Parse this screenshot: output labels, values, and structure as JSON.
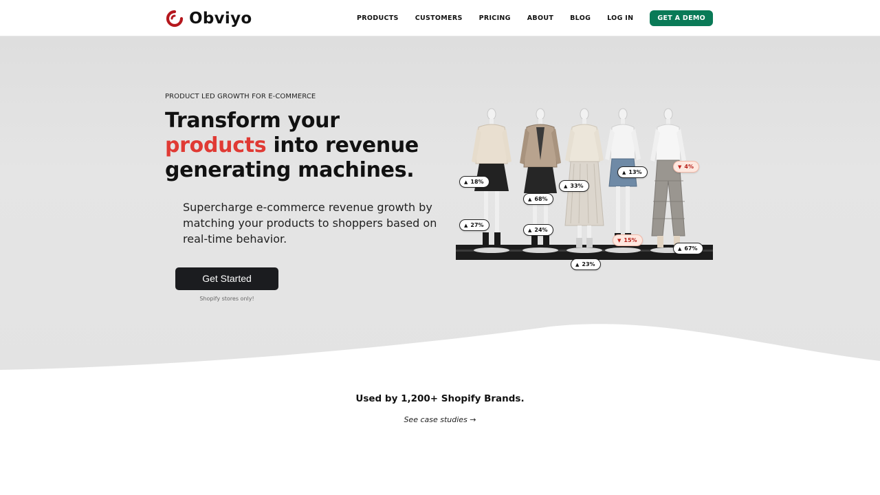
{
  "brand": {
    "name": "Obviyo",
    "accent_color": "#e03a34",
    "logo_icon": "obviyo-logo-icon"
  },
  "nav": {
    "items": [
      {
        "label": "PRODUCTS"
      },
      {
        "label": "CUSTOMERS"
      },
      {
        "label": "PRICING"
      },
      {
        "label": "ABOUT"
      },
      {
        "label": "BLOG"
      },
      {
        "label": "LOG IN"
      }
    ],
    "demo_label": "GET A DEMO",
    "demo_color": "#0a7a57"
  },
  "hero": {
    "eyebrow": "PRODUCT LED GROWTH FOR E-COMMERCE",
    "headline_line1": "Transform your",
    "headline_accent": "products",
    "headline_rest": " into revenue generating machines.",
    "subtext": "Supercharge e-commerce revenue growth by matching your products to shoppers based on real-time behavior.",
    "cta_label": "Get Started",
    "cta_note": "Shopify stores only!",
    "badges": [
      {
        "value": "18%",
        "direction": "up"
      },
      {
        "value": "27%",
        "direction": "up"
      },
      {
        "value": "68%",
        "direction": "up"
      },
      {
        "value": "24%",
        "direction": "up"
      },
      {
        "value": "33%",
        "direction": "up"
      },
      {
        "value": "23%",
        "direction": "up"
      },
      {
        "value": "13%",
        "direction": "up"
      },
      {
        "value": "15%",
        "direction": "down"
      },
      {
        "value": "4%",
        "direction": "down"
      },
      {
        "value": "67%",
        "direction": "up"
      }
    ],
    "arrow_up": "▲",
    "arrow_down": "▼"
  },
  "trust": {
    "title": "Used by 1,200+ Shopify Brands.",
    "case_link": "See case studies →"
  }
}
